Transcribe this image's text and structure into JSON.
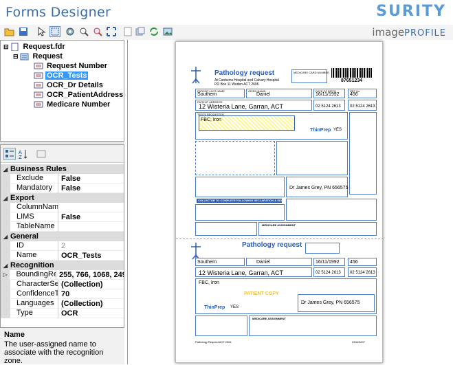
{
  "header": {
    "title": "Forms Designer",
    "brand": "SURITY",
    "product_a": "image",
    "product_b": "PROFILE"
  },
  "toolbar": {
    "icons": [
      "open-folder-icon",
      "save-icon",
      "pointer-icon",
      "select-zone-icon",
      "settings-icon",
      "zoom-in-icon",
      "zoom-out-icon",
      "fit-icon",
      "page-icon",
      "copy-icon",
      "refresh-icon",
      "image-icon"
    ]
  },
  "tree": {
    "root": "Request.fdr",
    "form": "Request",
    "zones": [
      "Request Number",
      "OCR_Tests",
      "OCR_Dr Details",
      "OCR_PatientAddress",
      "Medicare Number"
    ],
    "selected": "OCR_Tests"
  },
  "properties": {
    "categories": [
      {
        "name": "Business Rules",
        "rows": [
          {
            "name": "Exclude",
            "value": "False"
          },
          {
            "name": "Mandatory",
            "value": "False"
          }
        ]
      },
      {
        "name": "Export",
        "rows": [
          {
            "name": "ColumnName",
            "value": ""
          },
          {
            "name": "LIMS",
            "value": "False"
          },
          {
            "name": "TableName",
            "value": ""
          }
        ]
      },
      {
        "name": "General",
        "rows": [
          {
            "name": "ID",
            "value": "2"
          },
          {
            "name": "Name",
            "value": "OCR_Tests"
          }
        ]
      },
      {
        "name": "Recognition",
        "rows": [
          {
            "name": "BoundingRect",
            "value": "255, 766, 1068, 249"
          },
          {
            "name": "CharacterSets",
            "value": "(Collection)"
          },
          {
            "name": "ConfidenceTh",
            "value": "70"
          },
          {
            "name": "Languages",
            "value": "(Collection)"
          },
          {
            "name": "Type",
            "value": "OCR"
          }
        ]
      }
    ],
    "description_title": "Name",
    "description_text": "The user-assigned name to associate with the recognition zone."
  },
  "form": {
    "heading": "Pathology request",
    "sub1": "At Canberra Hospital and Calvary Hospital",
    "sub2": "PO Box 11 Woden ACT 2606",
    "medicare_label": "MEDICARE CARD NUMBER",
    "barcode_number": "87651234",
    "lastname_label": "PATIENT LAST NAME",
    "lastname": "Southern",
    "given_label": "GIVEN NAME",
    "given": "Daniel",
    "dob_label": "DATE OF BIRTH",
    "dob": "16/11/1992",
    "ref_label": "REF No",
    "ref": "456",
    "address_label": "PATIENT ADDRESS",
    "address": "12 Wisteria Lane, Garran, ACT",
    "phone": "02 5124 2613",
    "phone2": "02 5124 2613",
    "tests_label": "TESTS REQUESTED",
    "tests": "FBC, Iron",
    "thinprep": "ThinPrep",
    "yes": "YES",
    "doctor": "Dr James Grey, PN 656575",
    "collector": "COLLECTOR TO COMPLETE FOLLOWING DECLARATION & SIGN",
    "medicare_assignment": "MEDICARE ASSIGNMENT",
    "copy_heading": "Pathology request",
    "patient_copy": "PATIENT COPY",
    "footer_left": "Pathology Request ACT 2004",
    "footer_right": "2004/2007"
  }
}
